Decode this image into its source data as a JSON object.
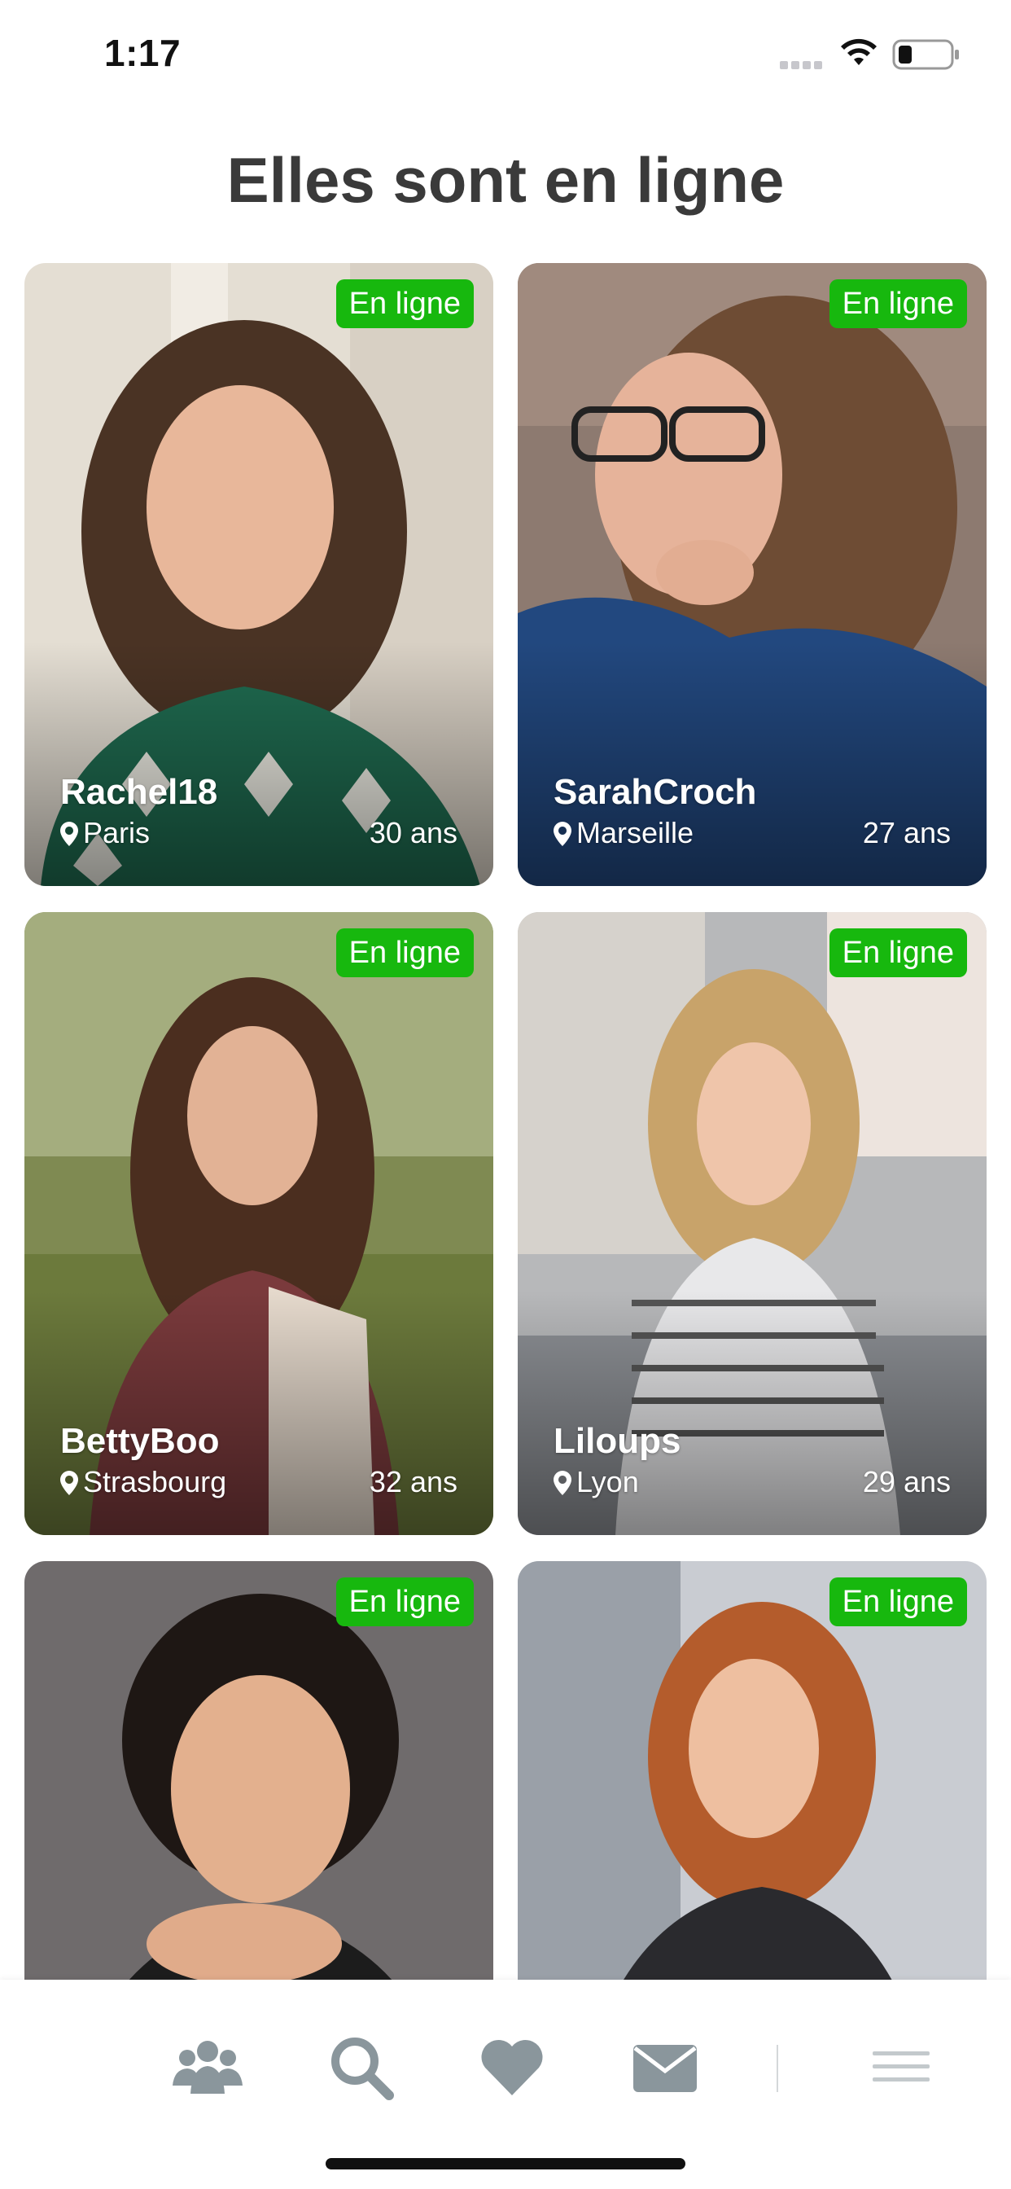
{
  "status_bar": {
    "time": "1:17"
  },
  "page_title": "Elles sont en ligne",
  "profiles": [
    {
      "username": "Rachel18",
      "city": "Paris",
      "age": "30 ans",
      "badge": "En ligne"
    },
    {
      "username": "SarahCroch",
      "city": "Marseille",
      "age": "27 ans",
      "badge": "En ligne"
    },
    {
      "username": "BettyBoo",
      "city": "Strasbourg",
      "age": "32 ans",
      "badge": "En ligne"
    },
    {
      "username": "Liloups",
      "city": "Lyon",
      "age": "29 ans",
      "badge": "En ligne"
    },
    {
      "username": "",
      "city": "",
      "age": "",
      "badge": "En ligne"
    },
    {
      "username": "",
      "city": "",
      "age": "",
      "badge": "En ligne"
    }
  ],
  "tabbar": {
    "icons": [
      "users-icon",
      "search-icon",
      "heart-icon",
      "envelope-icon",
      "menu-icon"
    ]
  },
  "colors": {
    "badge_green": "#17b80e",
    "tab_icon": "#8a969c",
    "title": "#3a3a3a"
  }
}
